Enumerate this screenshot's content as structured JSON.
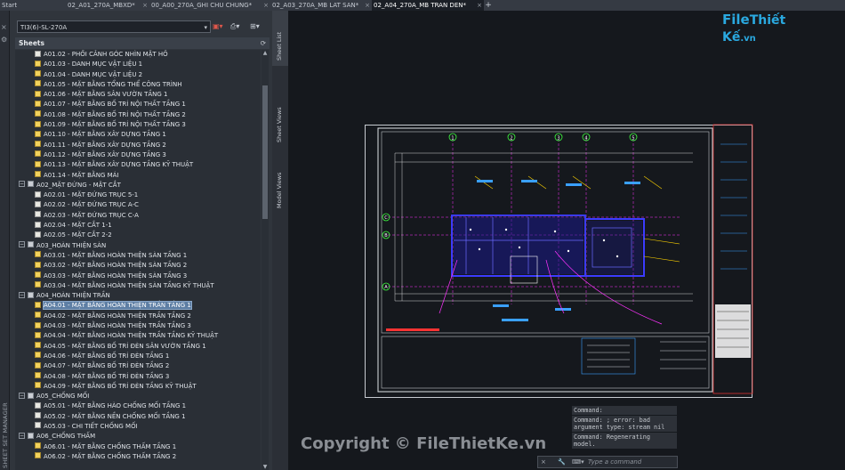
{
  "tabs": [
    {
      "label": "Start",
      "x": 0
    },
    {
      "label": "02_A01_270A_MBXD*"
    },
    {
      "label": "00_A00_270A_GHI CHU CHUNG*"
    },
    {
      "label": "02_A03_270A_MB LAT SAN*"
    },
    {
      "label": "02_A04_270A_MB TRAN DEN*",
      "active": true
    }
  ],
  "tab_add": "+",
  "sheet_set_manager": {
    "title": "SHEET SET MANAGER",
    "current_set": "TI3(6)-SL-270A",
    "sheets_header": "Sheets",
    "refresh_icon": "refresh-icon"
  },
  "side_tabs": [
    "Sheet List",
    "Sheet Views",
    "Model Views"
  ],
  "tree": [
    {
      "t": "file",
      "text": "A01.02 - PHỐI CẢNH GÓC NHÌN MẶT HỒ",
      "lvl": 2
    },
    {
      "t": "plot",
      "text": "A01.03 - DANH MỤC VẬT LIỆU 1",
      "lvl": 2
    },
    {
      "t": "plot",
      "text": "A01.04 - DANH MỤC VẬT LIỆU 2",
      "lvl": 2
    },
    {
      "t": "plot",
      "text": "A01.05 - MẶT BẰNG TỔNG THỂ CÔNG TRÌNH",
      "lvl": 2
    },
    {
      "t": "plot",
      "text": "A01.06 - MẶT BẰNG SÂN VƯỜN TẦNG 1",
      "lvl": 2
    },
    {
      "t": "plot",
      "text": "A01.07 - MẶT BẰNG BỐ TRÍ NỘI THẤT TẦNG 1",
      "lvl": 2
    },
    {
      "t": "plot",
      "text": "A01.08 - MẶT BẰNG BỐ TRÍ NỘI THẤT TẦNG 2",
      "lvl": 2
    },
    {
      "t": "plot",
      "text": "A01.09 - MẶT BẰNG BỐ TRÍ NỘI THẤT TẦNG 3",
      "lvl": 2
    },
    {
      "t": "plot",
      "text": "A01.10 - MẶT BẰNG XÂY DỰNG TẦNG 1",
      "lvl": 2
    },
    {
      "t": "plot",
      "text": "A01.11 - MẶT BẰNG XÂY DỰNG TẦNG 2",
      "lvl": 2
    },
    {
      "t": "plot",
      "text": "A01.12 - MẶT BẰNG XÂY DỰNG TẦNG 3",
      "lvl": 2
    },
    {
      "t": "plot",
      "text": "A01.13 - MẶT BẰNG XÂY DỰNG TẦNG KỸ THUẬT",
      "lvl": 2
    },
    {
      "t": "plot",
      "text": "A01.14 - MẶT BẰNG MÁI",
      "lvl": 2
    },
    {
      "t": "grp",
      "text": "A02_MẶT ĐỨNG - MẶT CẮT",
      "lvl": 1,
      "toggle": "−"
    },
    {
      "t": "file",
      "text": "A02.01 - MẶT ĐỨNG TRỤC 5-1",
      "lvl": 2
    },
    {
      "t": "file",
      "text": "A02.02 - MẶT ĐỨNG TRỤC A-C",
      "lvl": 2
    },
    {
      "t": "file",
      "text": "A02.03 - MẶT ĐỨNG TRỤC C-A",
      "lvl": 2
    },
    {
      "t": "file",
      "text": "A02.04 - MẶT CẮT 1-1",
      "lvl": 2
    },
    {
      "t": "file",
      "text": "A02.05 - MẶT CẮT 2-2",
      "lvl": 2
    },
    {
      "t": "grp",
      "text": "A03_HOÀN THIỆN SÀN",
      "lvl": 1,
      "toggle": "−"
    },
    {
      "t": "plot",
      "text": "A03.01 - MẶT BẰNG HOÀN THIỆN SÀN TẦNG 1",
      "lvl": 2
    },
    {
      "t": "plot",
      "text": "A03.02 - MẶT BẰNG HOÀN THIỆN SÀN TẦNG 2",
      "lvl": 2
    },
    {
      "t": "plot",
      "text": "A03.03 - MẶT BẰNG HOÀN THIỆN SÀN TẦNG 3",
      "lvl": 2
    },
    {
      "t": "plot",
      "text": "A03.04 - MẶT BẰNG HOÀN THIỆN SÀN TẦNG KỸ THUẬT",
      "lvl": 2
    },
    {
      "t": "grp",
      "text": "A04_HOÀN THIỆN TRẦN",
      "lvl": 1,
      "toggle": "−"
    },
    {
      "t": "plot",
      "text": "A04.01 - MẶT BẰNG HOÀN THIỆN TRẦN TẦNG 1",
      "lvl": 2,
      "selected": true
    },
    {
      "t": "plot",
      "text": "A04.02 - MẶT BẰNG HOÀN THIỆN TRẦN TẦNG 2",
      "lvl": 2
    },
    {
      "t": "plot",
      "text": "A04.03 - MẶT BẰNG HOÀN THIỆN TRẦN TẦNG 3",
      "lvl": 2
    },
    {
      "t": "plot",
      "text": "A04.04 - MẶT BẰNG HOÀN THIỆN TRẦN TẦNG KỸ THUẬT",
      "lvl": 2
    },
    {
      "t": "plot",
      "text": "A04.05 - MẶT BẰNG BỐ TRÍ ĐÈN SÂN VƯỜN TẦNG 1",
      "lvl": 2
    },
    {
      "t": "plot",
      "text": "A04.06 - MẶT BẰNG BỐ TRÍ ĐÈN TẦNG 1",
      "lvl": 2
    },
    {
      "t": "plot",
      "text": "A04.07 - MẶT BẰNG BỐ TRÍ ĐÈN TẦNG 2",
      "lvl": 2
    },
    {
      "t": "plot",
      "text": "A04.08 - MẶT BẰNG BỐ TRÍ ĐÈN TẦNG 3",
      "lvl": 2
    },
    {
      "t": "plot",
      "text": "A04.09 - MẶT BẰNG BỐ TRÍ ĐÈN TẦNG KỸ THUẬT",
      "lvl": 2
    },
    {
      "t": "grp",
      "text": "A05_CHỐNG MỐI",
      "lvl": 1,
      "toggle": "−"
    },
    {
      "t": "file",
      "text": "A05.01 - MẶT BẰNG HÀO CHỐNG MỐI TẦNG 1",
      "lvl": 2
    },
    {
      "t": "file",
      "text": "A05.02 - MẶT BẰNG NỀN CHỐNG MỐI TẦNG 1",
      "lvl": 2
    },
    {
      "t": "file",
      "text": "A05.03 - CHI TIẾT CHỐNG MỐI",
      "lvl": 2
    },
    {
      "t": "grp",
      "text": "A06_CHỐNG THẤM",
      "lvl": 1,
      "toggle": "−"
    },
    {
      "t": "plot",
      "text": "A06.01 - MẶT BẰNG CHỐNG THẤM TẦNG 1",
      "lvl": 2
    },
    {
      "t": "plot",
      "text": "A06.02 - MẶT BẰNG CHỐNG THẤM TẦNG 2",
      "lvl": 2
    }
  ],
  "command_history": [
    "Command:",
    "Command: ; error: bad argument type: stream nil",
    "Command: Regenerating model."
  ],
  "command_placeholder": "Type a command",
  "logo": {
    "part1": "File",
    "part2": "Thiết Kế",
    "part3": ".vn"
  },
  "watermark": "Copyright © FileThietKe.vn",
  "grid_bubbles_top": [
    "1",
    "2",
    "3",
    "4",
    "5"
  ],
  "grid_bubbles_left": [
    "C",
    "B",
    "A"
  ],
  "colors": {
    "accent": "#2aa9e0",
    "selection": "#5d7ea4",
    "plan_wall": "#3b3bff",
    "plan_grid": "#ff33ff",
    "plan_dim": "#40ff40"
  }
}
